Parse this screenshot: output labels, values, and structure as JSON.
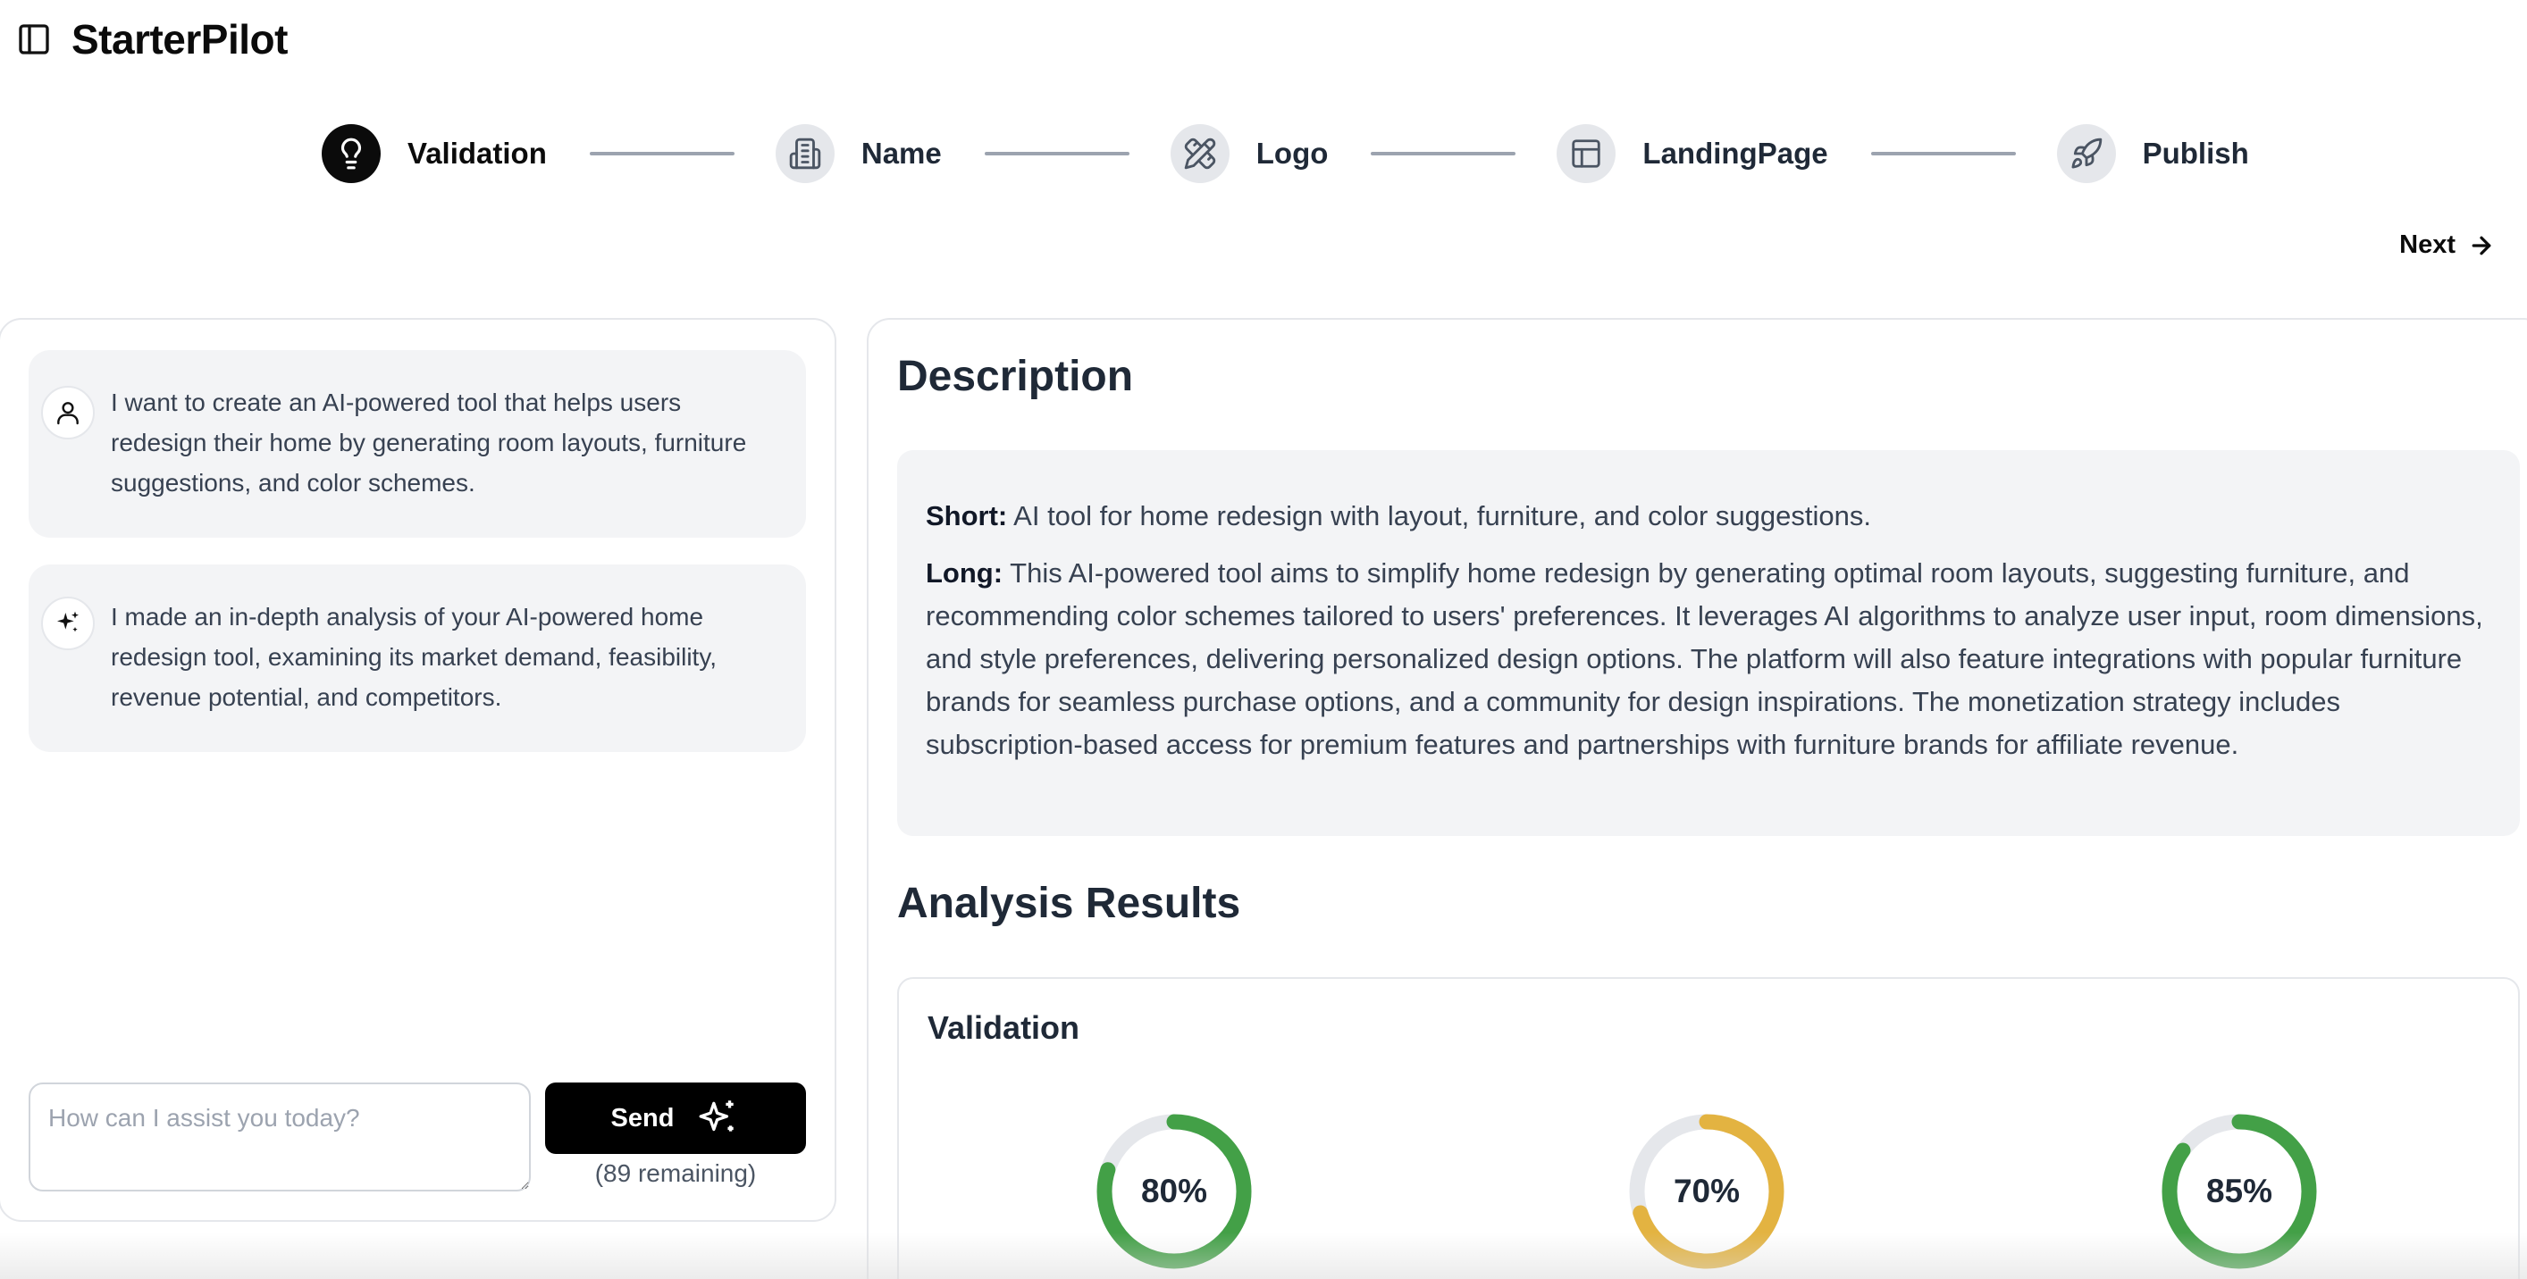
{
  "app": {
    "title": "StarterPilot",
    "sidebar_toggle_icon": "sidebar-panel-icon"
  },
  "stepper": {
    "steps": [
      {
        "label": "Validation",
        "icon": "lightbulb-icon",
        "active": true
      },
      {
        "label": "Name",
        "icon": "building-icon",
        "active": false
      },
      {
        "label": "Logo",
        "icon": "pencil-ruler-icon",
        "active": false
      },
      {
        "label": "LandingPage",
        "icon": "layout-icon",
        "active": false
      },
      {
        "label": "Publish",
        "icon": "rocket-icon",
        "active": false
      }
    ],
    "next_label": "Next",
    "next_icon": "arrow-right-icon"
  },
  "chat": {
    "messages": [
      {
        "role": "user",
        "icon": "user-icon",
        "text": "I want to create an AI-powered tool that helps users redesign their home by generating room layouts, furniture suggestions, and color schemes."
      },
      {
        "role": "assistant",
        "icon": "sparkles-icon",
        "text": "I made an in-depth analysis of your AI-powered home redesign tool, examining its market demand, feasibility, revenue potential, and competitors."
      }
    ],
    "input_placeholder": "How can I assist you today?",
    "send_label": "Send",
    "send_icon": "sparkles-icon",
    "remaining": "(89 remaining)"
  },
  "description": {
    "title": "Description",
    "short_label": "Short:",
    "short_text": "AI tool for home redesign with layout, furniture, and color suggestions.",
    "long_label": "Long:",
    "long_text": "This AI-powered tool aims to simplify home redesign by generating optimal room layouts, suggesting furniture, and recommending color schemes tailored to users' preferences. It leverages AI algorithms to analyze user input, room dimensions, and style preferences, delivering personalized design options. The platform will also feature integrations with popular furniture brands for seamless purchase options, and a community for design inspirations. The monetization strategy includes subscription-based access for premium features and partnerships with furniture brands for affiliate revenue."
  },
  "analysis": {
    "title": "Analysis Results",
    "validation": {
      "title": "Validation",
      "gauges": [
        {
          "label": "80%",
          "value": 80,
          "color": "#43a047"
        },
        {
          "label": "70%",
          "value": 70,
          "color": "#e3b341"
        },
        {
          "label": "85%",
          "value": 85,
          "color": "#43a047"
        }
      ],
      "track_color": "#e5e7eb"
    }
  }
}
